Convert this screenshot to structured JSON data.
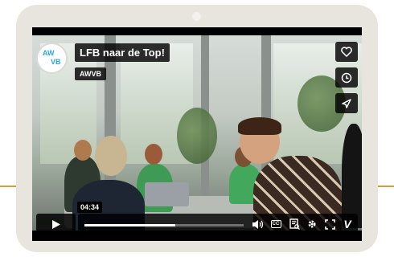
{
  "video": {
    "title": "LFB naar de Top!",
    "channel": "AWVB",
    "logo_line1": "AW",
    "logo_line2": "VB",
    "timestamp": "04:34",
    "progress": 0.57
  },
  "side_actions": [
    {
      "name": "like",
      "icon": "heart-icon"
    },
    {
      "name": "watch-later",
      "icon": "clock-icon"
    },
    {
      "name": "share",
      "icon": "share-icon"
    }
  ],
  "control_icons": [
    "play-icon",
    "volume-icon",
    "cc-icon",
    "transcript-icon",
    "settings-icon",
    "fullscreen-icon",
    "vimeo-icon"
  ],
  "controls": {
    "cc_label": "CC",
    "vimeo_label": "V"
  },
  "colors": {
    "accent_line": "#c9a13f",
    "tablet": "#e8e4de",
    "logo_text": "#2aa7d8"
  }
}
